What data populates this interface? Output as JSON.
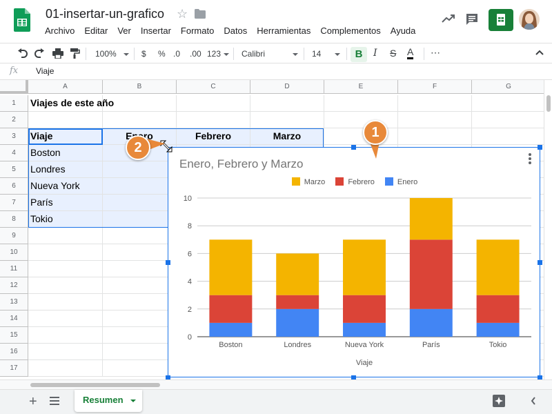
{
  "header": {
    "doc_title": "01-insertar-un-grafico",
    "menu": [
      "Archivo",
      "Editar",
      "Ver",
      "Insertar",
      "Formato",
      "Datos",
      "Herramientas",
      "Complementos",
      "Ayuda"
    ],
    "brand_color": "#0f9d58"
  },
  "toolbar": {
    "zoom": "100%",
    "currency": "$",
    "percent": "%",
    "decrease_decimals": ".0",
    "increase_decimals": ".00",
    "format_more": "123",
    "font": "Calibri",
    "font_size": "14",
    "bold": "B",
    "italic": "I",
    "strike": "S",
    "text_color": "A",
    "more": "⋯"
  },
  "formula_bar": {
    "fx": "fx",
    "value": "Viaje"
  },
  "grid": {
    "columns": [
      "A",
      "B",
      "C",
      "D",
      "E",
      "F",
      "G"
    ],
    "rows": [
      "1",
      "2",
      "3",
      "4",
      "5",
      "6",
      "7",
      "8",
      "9",
      "10",
      "11",
      "12",
      "13",
      "14",
      "15",
      "16",
      "17"
    ],
    "title_cell": "Viajes de este año",
    "headers": {
      "a": "Viaje",
      "b": "Enero",
      "c": "Febrero",
      "d": "Marzo"
    },
    "cities": [
      "Boston",
      "Londres",
      "Nueva York",
      "París",
      "Tokio"
    ]
  },
  "chart_data": {
    "type": "bar",
    "stacked": true,
    "title": "Enero, Febrero y Marzo",
    "xlabel": "Viaje",
    "ylabel": "",
    "ylim": [
      0,
      10
    ],
    "yticks": [
      0,
      2,
      4,
      6,
      8,
      10
    ],
    "categories": [
      "Boston",
      "Londres",
      "Nueva York",
      "París",
      "Tokio"
    ],
    "series": [
      {
        "name": "Enero",
        "color": "#4285f4",
        "values": [
          1,
          2,
          1,
          2,
          1
        ]
      },
      {
        "name": "Febrero",
        "color": "#db4437",
        "values": [
          2,
          1,
          2,
          5,
          2
        ]
      },
      {
        "name": "Marzo",
        "color": "#f4b400",
        "values": [
          4,
          3,
          4,
          3,
          4
        ]
      }
    ],
    "legend_order": [
      "Marzo",
      "Febrero",
      "Enero"
    ],
    "legend_position": "top",
    "grid": true
  },
  "callouts": {
    "one": "1",
    "two": "2"
  },
  "sheets": {
    "active": "Resumen"
  },
  "colors": {
    "accent": "#1a73e8",
    "green": "#188038",
    "callout": "#e8893a"
  }
}
